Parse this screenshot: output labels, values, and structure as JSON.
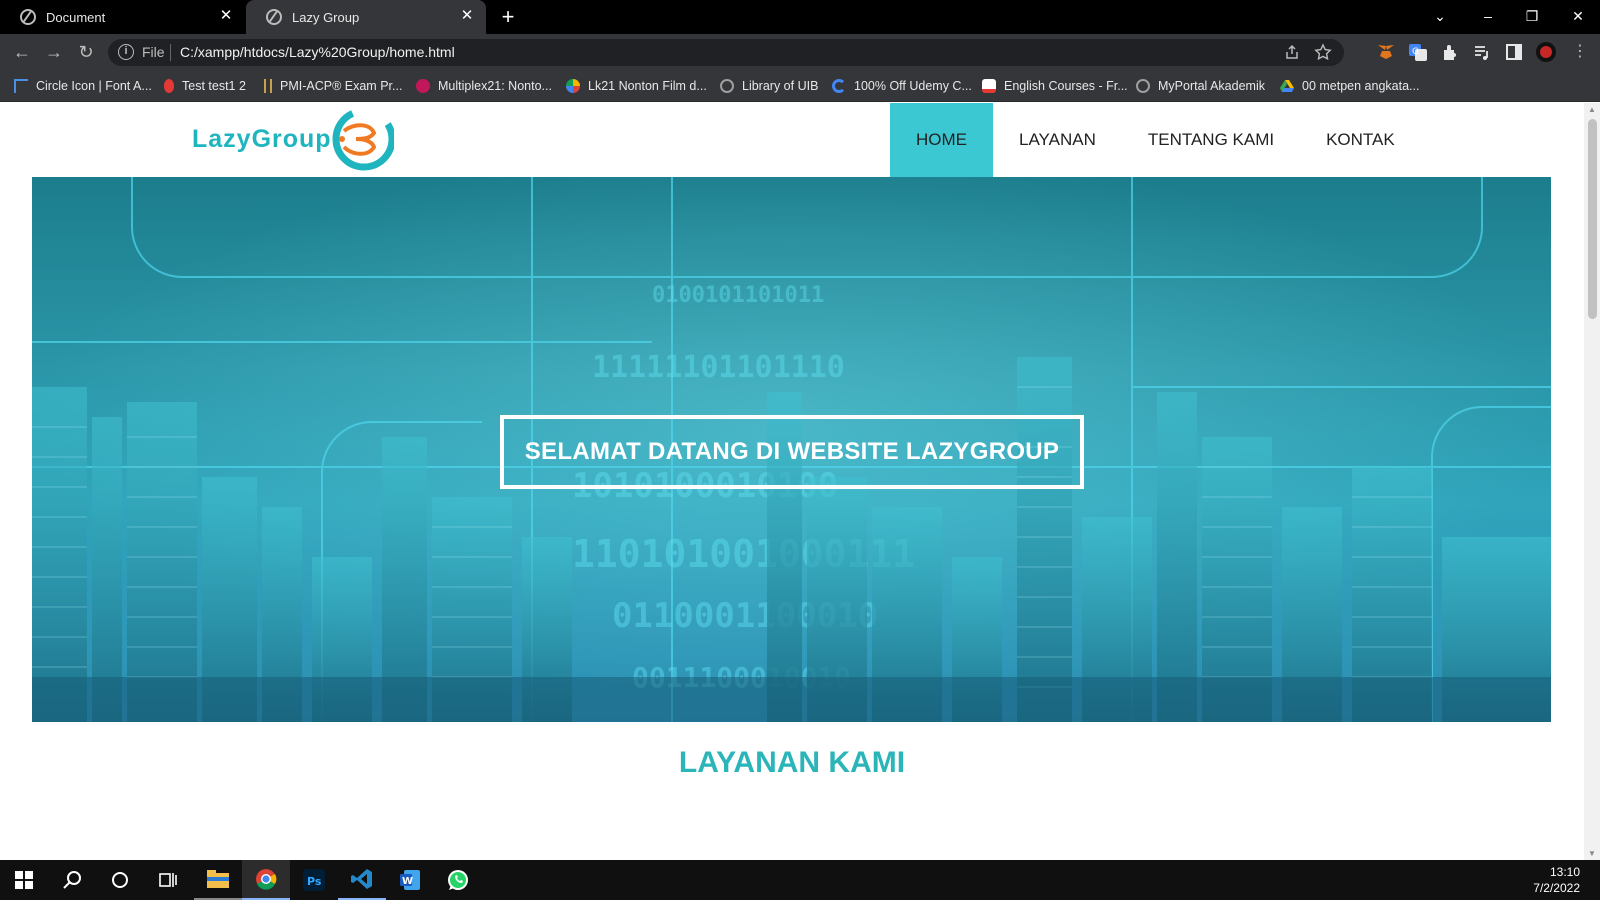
{
  "browser": {
    "tabs": [
      {
        "title": "Document",
        "active": false
      },
      {
        "title": "Lazy Group",
        "active": true
      }
    ],
    "address": {
      "scheme_label": "File",
      "url": "C:/xampp/htdocs/Lazy%20Group/home.html"
    },
    "bookmarks": [
      {
        "label": "Circle Icon | Font A...",
        "icon": "flag-icon",
        "color": "#4a90e2"
      },
      {
        "label": "Test test1 2",
        "icon": "pin-icon",
        "color": "#e53935"
      },
      {
        "label": "PMI-ACP® Exam Pr...",
        "icon": "ladder-icon",
        "color": "#c8a24a"
      },
      {
        "label": "Multiplex21: Nonto...",
        "icon": "m21-icon",
        "color": "#c2185b"
      },
      {
        "label": "Lk21 Nonton Film d...",
        "icon": "multicolor-icon",
        "color": "#f4b400"
      },
      {
        "label": "Library of UIB",
        "icon": "globe-icon",
        "color": "#9e9e9e"
      },
      {
        "label": "100% Off Udemy C...",
        "icon": "g-icon",
        "color": "#4285f4"
      },
      {
        "label": "English Courses - Fr...",
        "icon": "alison-icon",
        "color": "#ffffff"
      },
      {
        "label": "MyPortal Akademik",
        "icon": "globe-icon",
        "color": "#9e9e9e"
      },
      {
        "label": "00 metpen angkata...",
        "icon": "drive-icon",
        "color": "#34a853"
      }
    ]
  },
  "site": {
    "logo_text": "LazyGroup",
    "nav": [
      {
        "label": "HOME",
        "active": true
      },
      {
        "label": "LAYANAN",
        "active": false
      },
      {
        "label": "TENTANG KAMI",
        "active": false
      },
      {
        "label": "KONTAK",
        "active": false
      }
    ],
    "hero_title": "SELAMAT DATANG DI WEBSITE LAZYGROUP",
    "section_title": "LAYANAN KAMI",
    "accent_color": "#3cc8d3"
  },
  "taskbar": {
    "time": "13:10",
    "date": "7/2/2022",
    "apps": [
      "windows-start-icon",
      "search-icon",
      "cortana-icon",
      "task-view-icon",
      "file-explorer-icon",
      "chrome-icon",
      "photoshop-icon",
      "vscode-icon",
      "word-icon",
      "whatsapp-icon"
    ]
  }
}
